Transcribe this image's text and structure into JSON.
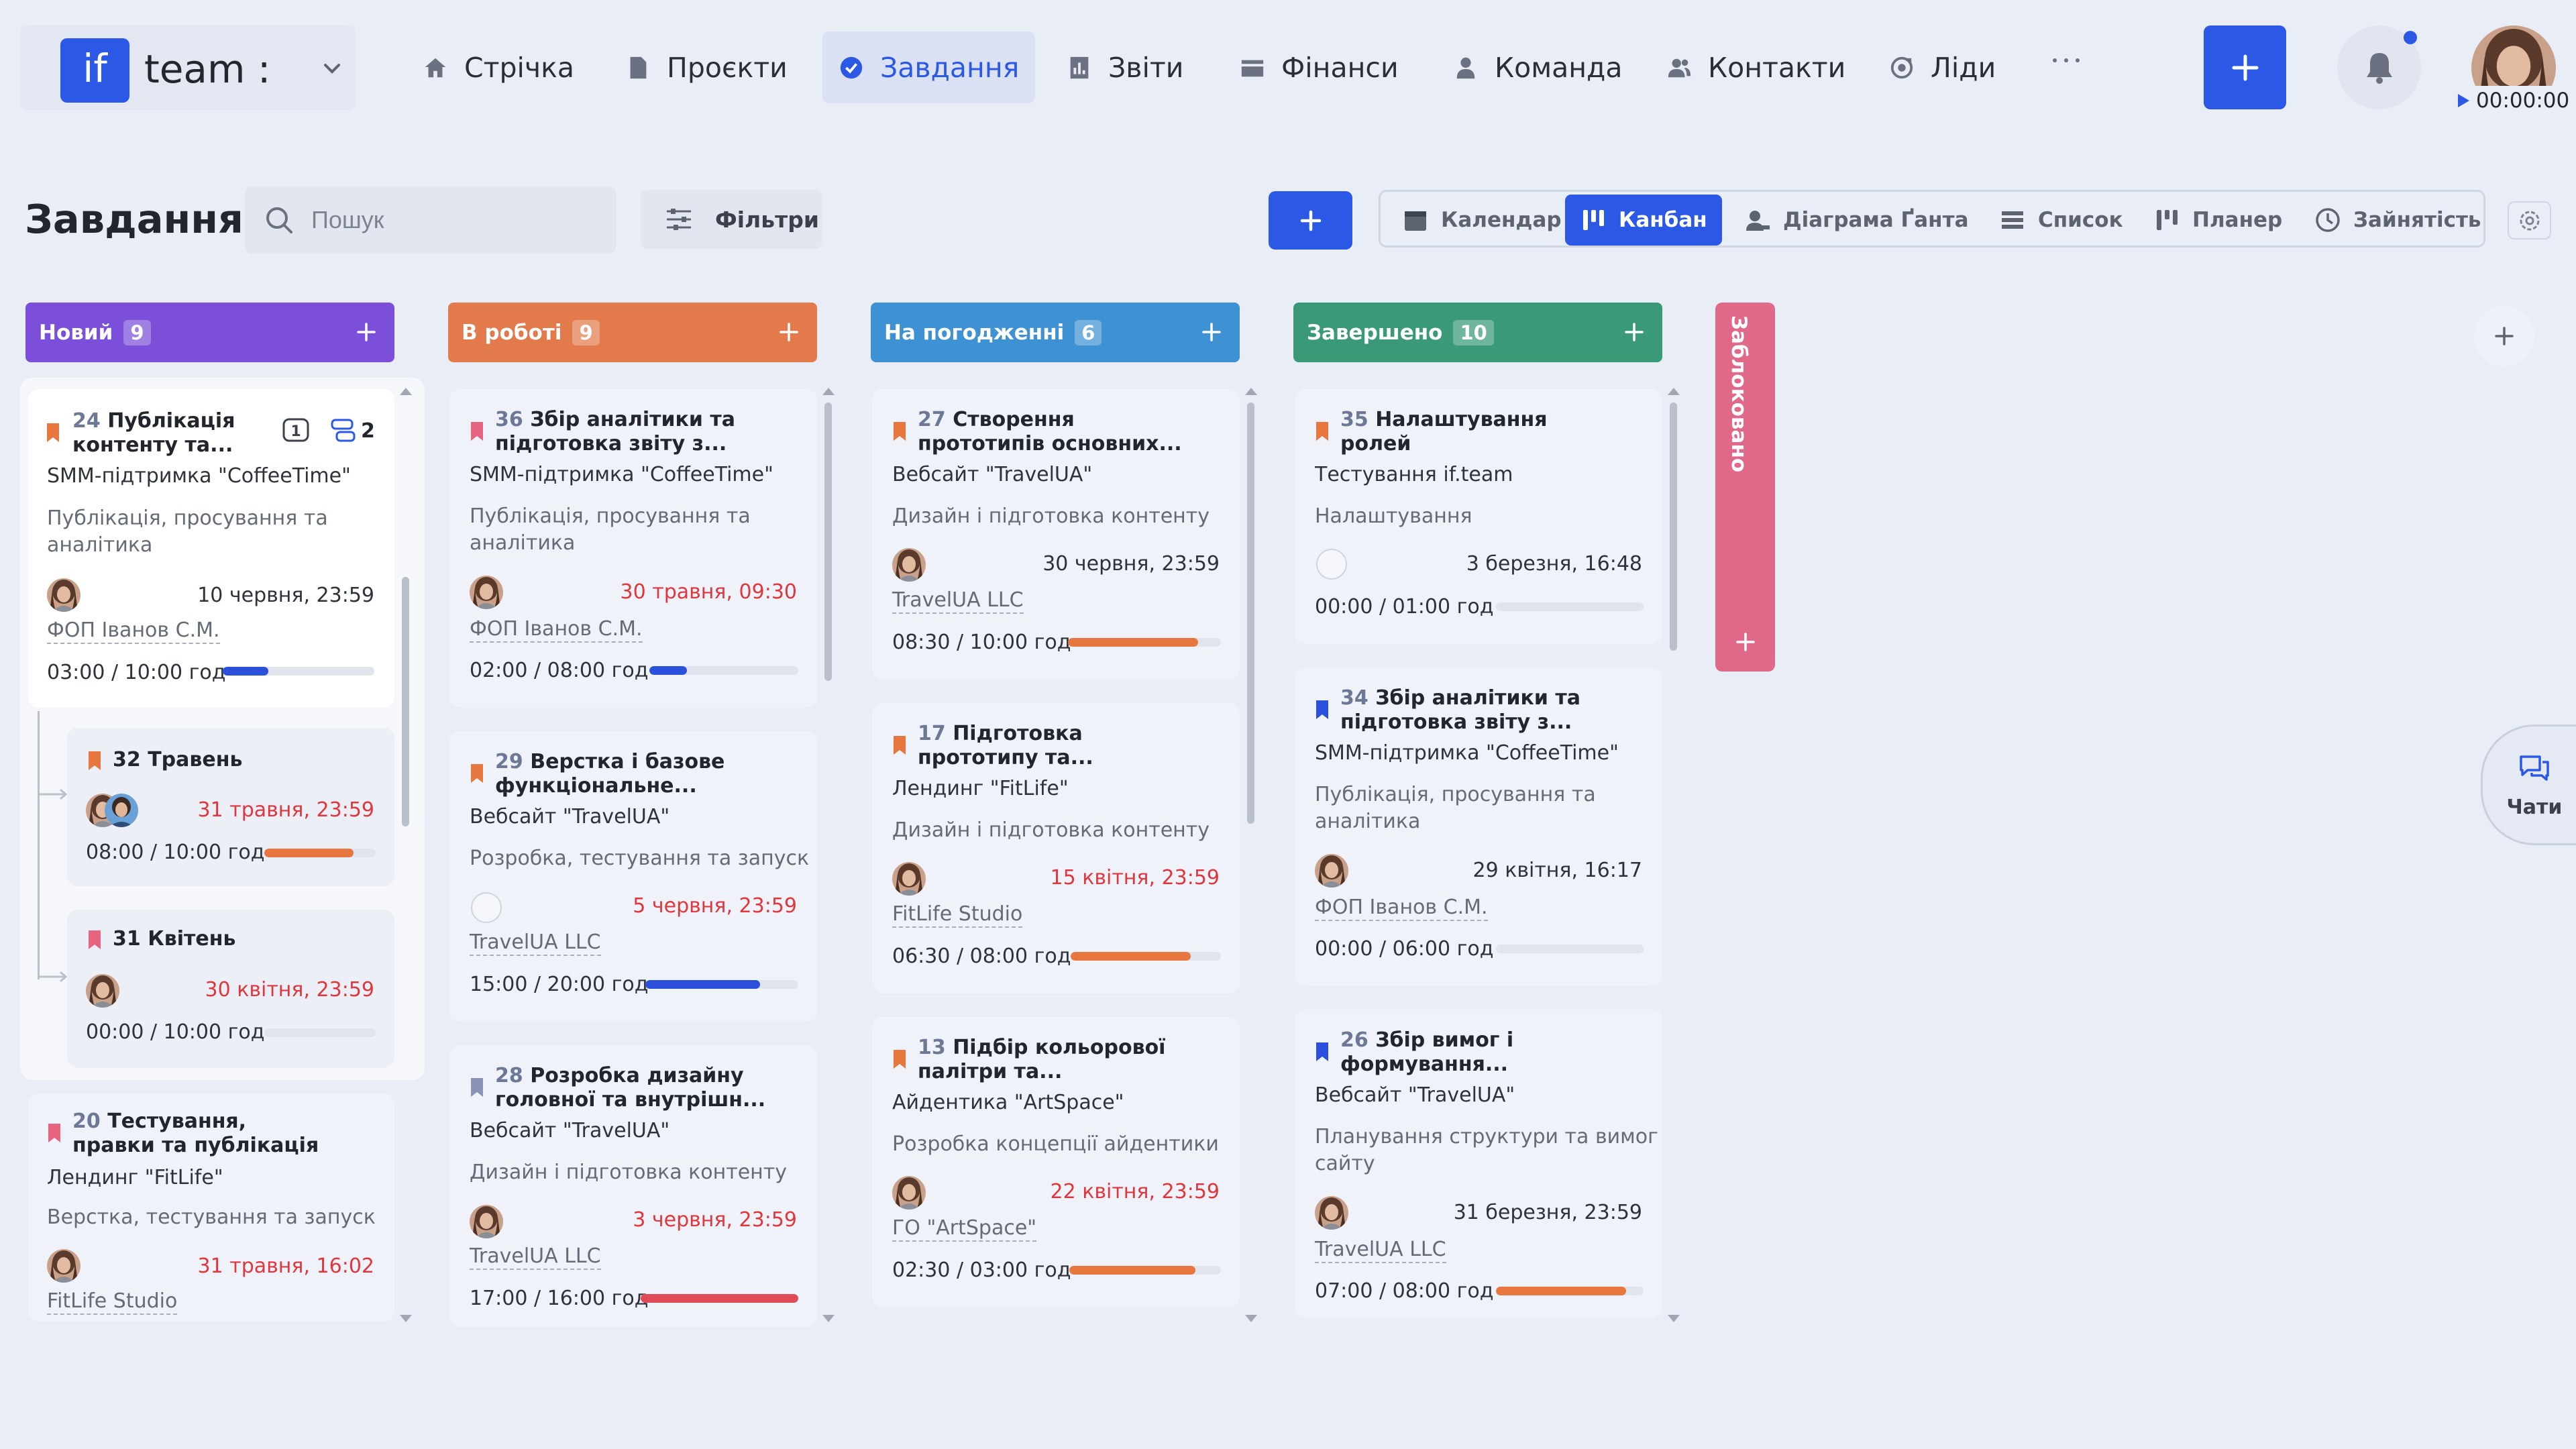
{
  "app": {
    "logo_short": "if",
    "workspace": "team :"
  },
  "nav": [
    {
      "label": "Стрічка",
      "icon": "home-icon"
    },
    {
      "label": "Проєкти",
      "icon": "file-icon"
    },
    {
      "label": "Завдання",
      "icon": "check-circle-icon",
      "active": true
    },
    {
      "label": "Звіти",
      "icon": "report-icon"
    },
    {
      "label": "Фінанси",
      "icon": "wallet-icon"
    },
    {
      "label": "Команда",
      "icon": "user-icon"
    },
    {
      "label": "Контакти",
      "icon": "contacts-icon"
    },
    {
      "label": "Ліди",
      "icon": "leads-icon"
    }
  ],
  "nav_more": "···",
  "timer": "00:00:00",
  "page": {
    "title": "Завдання",
    "search_placeholder": "Пошук",
    "filters_label": "Фільтри"
  },
  "views": [
    {
      "label": "Календар",
      "icon": "calendar-icon"
    },
    {
      "label": "Канбан",
      "icon": "kanban-icon",
      "active": true
    },
    {
      "label": "Діаграма Ґанта",
      "icon": "gantt-icon"
    },
    {
      "label": "Список",
      "icon": "list-icon"
    },
    {
      "label": "Планер",
      "icon": "planner-icon"
    },
    {
      "label": "Зайнятість",
      "icon": "clock-icon"
    }
  ],
  "columns": [
    {
      "name": "Новий",
      "count": "9",
      "color": "#7b4fd9"
    },
    {
      "name": "В роботі",
      "count": "9",
      "color": "#e27a4c"
    },
    {
      "name": "На погодженні",
      "count": "6",
      "color": "#3e91d3"
    },
    {
      "name": "Завершено",
      "count": "10",
      "color": "#3a9a78"
    }
  ],
  "locked_column": "Заблоковано",
  "chats_label": "Чати",
  "col_new": {
    "card_24": {
      "num": "24",
      "title1": "Публікація",
      "title2": "контенту та...",
      "project": "SMM-підтримка \"CoffeeTime\"",
      "stage1": "Публікація, просування та",
      "stage2": "аналітика",
      "date": "10 червня, 23:59",
      "client": "ФОП Іванов С.М.",
      "time": "03:00 / 10:00 год",
      "progress": 0.3,
      "bar_color": "#2b50db",
      "checklist": "1",
      "subtasks": "2",
      "flag": "#e8773f"
    },
    "card_32": {
      "num": "32",
      "title": "Травень",
      "date": "31 травня, 23:59",
      "time": "08:00 / 10:00 год",
      "progress": 0.8,
      "bar_color": "#e8773f",
      "flag": "#e8773f"
    },
    "card_31": {
      "num": "31",
      "title": "Квітень",
      "date": "30 квітня, 23:59",
      "time": "00:00 / 10:00 год",
      "progress": 0,
      "flag": "#e66480"
    },
    "card_20": {
      "num": "20",
      "title1": "Тестування,",
      "title2": "правки та публікація",
      "project": "Лендинг \"FitLife\"",
      "stage": "Верстка, тестування та запуск",
      "date": "31 травня, 16:02",
      "client": "FitLife Studio",
      "flag": "#e66480"
    }
  },
  "col_work": {
    "card_36": {
      "num": "36",
      "title1": "Збір аналітики та",
      "title2": "підготовка звіту з...",
      "project": "SMM-підтримка \"CoffeeTime\"",
      "stage1": "Публікація, просування та",
      "stage2": "аналітика",
      "date": "30 травня, 09:30",
      "client": "ФОП Іванов С.М.",
      "time": "02:00 / 08:00 год",
      "progress": 0.25,
      "bar_color": "#2b50db",
      "flag": "#e66480"
    },
    "card_29": {
      "num": "29",
      "title1": "Верстка і базове",
      "title2": "функціональне...",
      "project": "Вебсайт \"TravelUA\"",
      "stage": "Розробка, тестування та запуск",
      "date": "5 червня, 23:59",
      "client": "TravelUA LLC",
      "time": "15:00 / 20:00 год",
      "progress": 0.75,
      "bar_color": "#2b50db",
      "flag": "#e8773f"
    },
    "card_28": {
      "num": "28",
      "title1": "Розробка дизайну",
      "title2": "головної та внутрішн...",
      "project": "Вебсайт \"TravelUA\"",
      "stage": "Дизайн і підготовка контенту",
      "date": "3 червня, 23:59",
      "client": "TravelUA LLC",
      "time": "17:00 / 16:00 год",
      "progress": 1,
      "bar_color": "#e04a57",
      "flag": "#8a94b4"
    }
  },
  "col_review": {
    "card_27": {
      "num": "27",
      "title1": "Створення",
      "title2": "прототипів основних...",
      "project": "Вебсайт \"TravelUA\"",
      "stage": "Дизайн і підготовка контенту",
      "date": "30 червня, 23:59",
      "client": "TravelUA LLC",
      "time": "08:30 / 10:00 год",
      "progress": 0.85,
      "bar_color": "#e8773f",
      "flag": "#e8773f"
    },
    "card_17": {
      "num": "17",
      "title1": "Підготовка",
      "title2": "прототипу та...",
      "project": "Лендинг \"FitLife\"",
      "stage": "Дизайн і підготовка контенту",
      "date": "15 квітня, 23:59",
      "client": "FitLife Studio",
      "time": "06:30 / 08:00 год",
      "progress": 0.8,
      "bar_color": "#e8773f",
      "flag": "#e8773f"
    },
    "card_13": {
      "num": "13",
      "title1": "Підбір кольорової",
      "title2": "палітри та...",
      "project": "Айдентика \"ArtSpace\"",
      "stage": "Розробка концепції айдентики",
      "date": "22 квітня, 23:59",
      "client": "ГО \"ArtSpace\"",
      "time": "02:30 / 03:00 год",
      "progress": 0.83,
      "bar_color": "#e8773f",
      "flag": "#e8773f"
    }
  },
  "col_done": {
    "card_35": {
      "num": "35",
      "title1": "Налаштування",
      "title2": "ролей",
      "project": "Тестування if.team",
      "stage": "Налаштування",
      "date": "3 березня, 16:48",
      "time": "00:00 / 01:00 год",
      "progress": 0,
      "flag": "#e8773f"
    },
    "card_34": {
      "num": "34",
      "title1": "Збір аналітики та",
      "title2": "підготовка звіту з...",
      "project": "SMM-підтримка \"CoffeeTime\"",
      "stage1": "Публікація, просування та",
      "stage2": "аналітика",
      "date": "29 квітня, 16:17",
      "client": "ФОП Іванов С.М.",
      "time": "00:00 / 06:00 год",
      "progress": 0,
      "flag": "#2b50db"
    },
    "card_26": {
      "num": "26",
      "title1": "Збір вимог і",
      "title2": "формування...",
      "project": "Вебсайт \"TravelUA\"",
      "stage1": "Планування структури та вимог",
      "stage2": "сайту",
      "date": "31 березня, 23:59",
      "client": "TravelUA LLC",
      "time": "07:00 / 08:00 год",
      "progress": 0.88,
      "bar_color": "#e8773f",
      "flag": "#2b50db"
    }
  }
}
